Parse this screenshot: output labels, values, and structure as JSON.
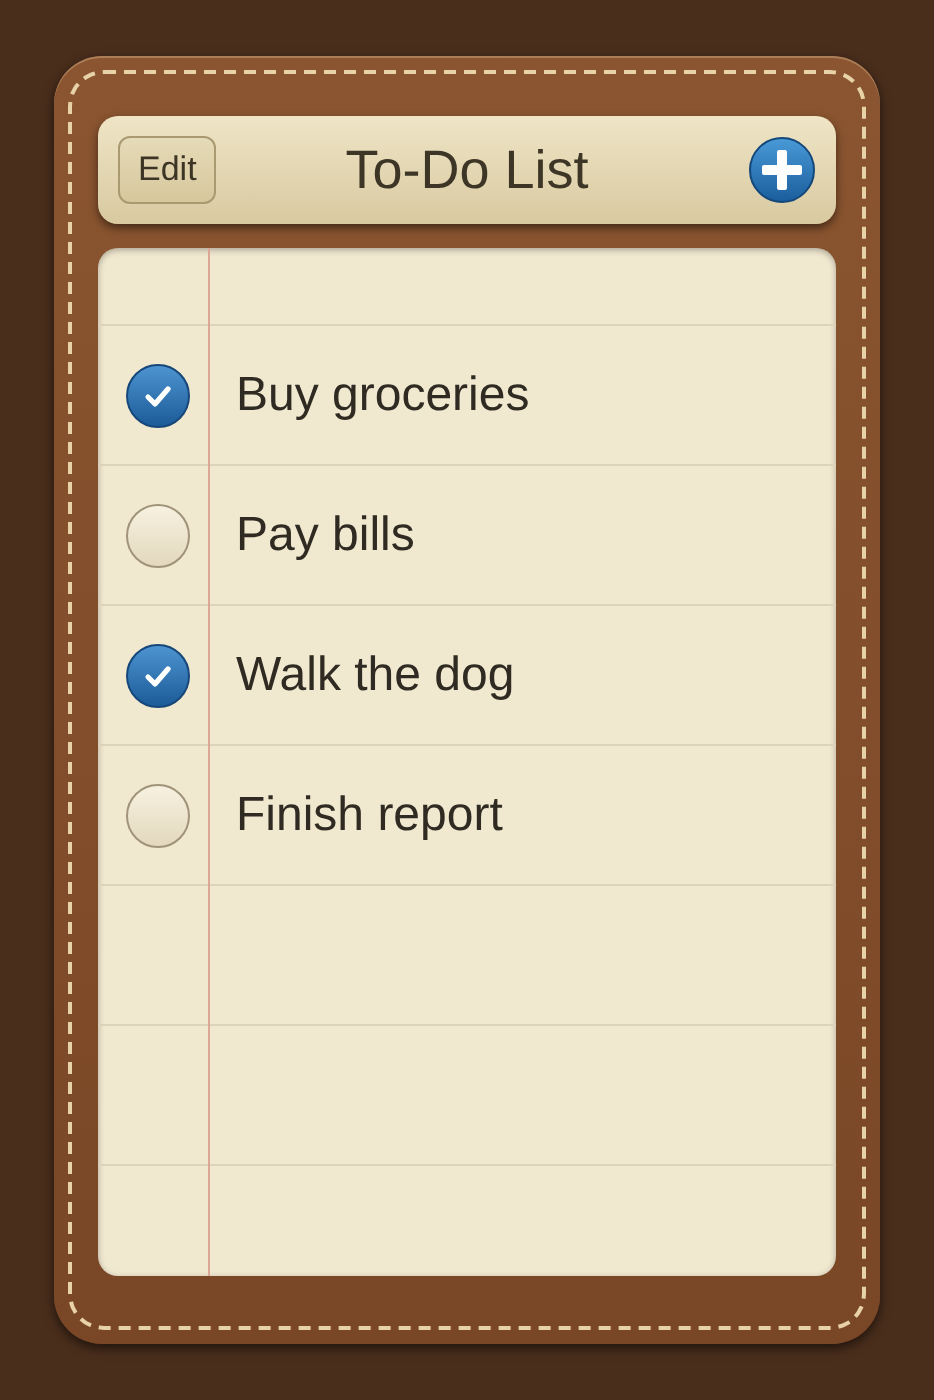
{
  "header": {
    "edit_button": "Edit",
    "title": "To-Do List"
  },
  "tasks": [
    {
      "label": "Buy groceries",
      "checked": true
    },
    {
      "label": "Pay bills",
      "checked": false
    },
    {
      "label": "Walk the dog",
      "checked": true
    },
    {
      "label": "Finish report",
      "checked": false
    }
  ]
}
